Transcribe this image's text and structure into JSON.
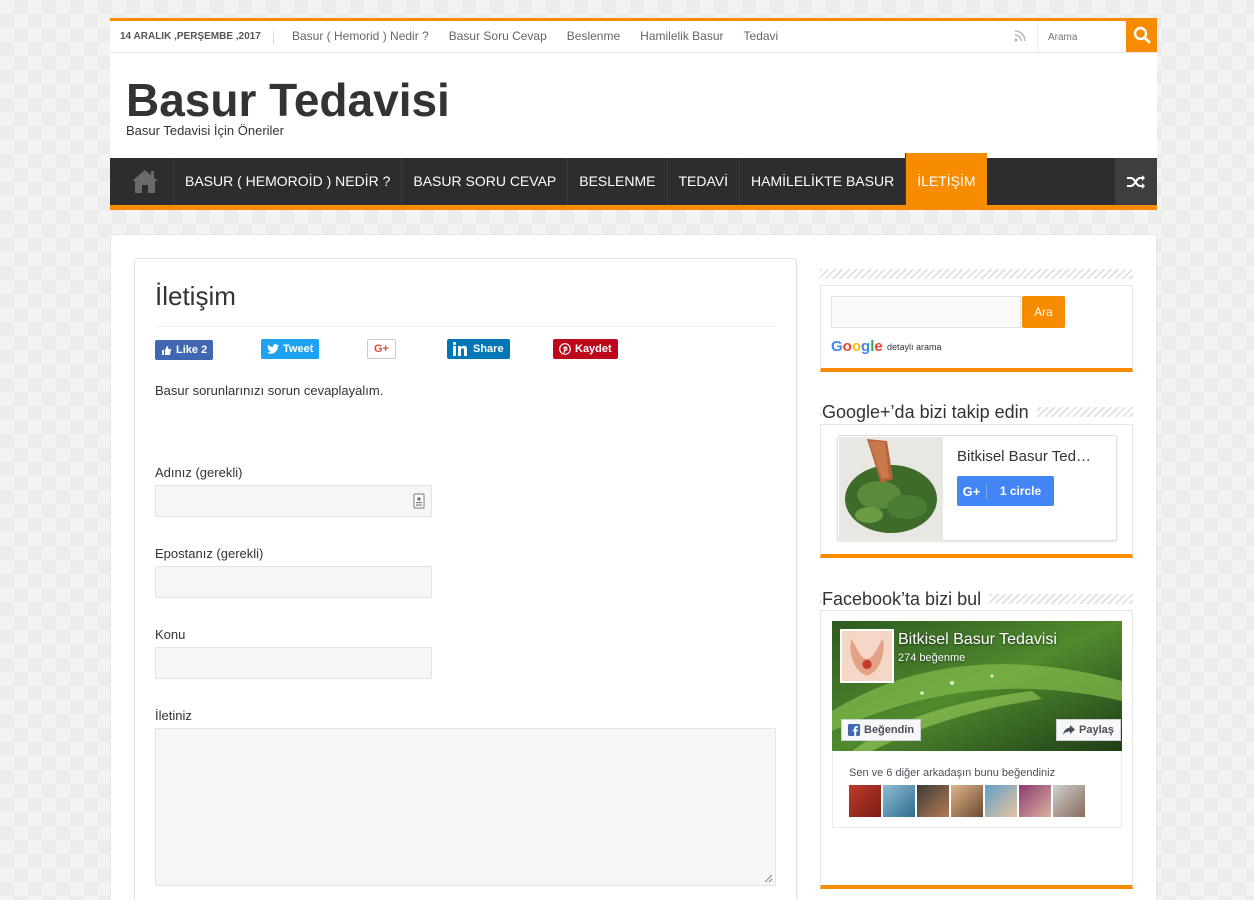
{
  "topbar": {
    "date": "14 ARALIK ,PERŞEMBE ,2017",
    "links": [
      "Basur ( Hemorid ) Nedir ?",
      "Basur Soru Cevap",
      "Beslenme",
      "Hamilelik Basur",
      "Tedavi"
    ],
    "search_placeholder": "Arama"
  },
  "header": {
    "logo": "Basur Tedavisi",
    "tagline": "Basur Tedavisi İçin Öneriler"
  },
  "nav": {
    "items": [
      "BASUR ( HEMOROİD ) NEDİR ?",
      "BASUR SORU CEVAP",
      "BESLENME",
      "TEDAVİ",
      "HAMİLELİKTE BASUR",
      "İLETİŞİM"
    ],
    "active_index": 5
  },
  "post": {
    "title": "İletişim",
    "share": {
      "fb": "Like 2",
      "tw": "Tweet",
      "gp": "G+",
      "li": "Share",
      "pi": "Kaydet"
    },
    "intro": "Basur sorunlarınızı sorun cevaplayalım.",
    "form": {
      "name_label": "Adınız (gerekli)",
      "email_label": "Epostanız (gerekli)",
      "subject_label": "Konu",
      "message_label": "İletiniz"
    }
  },
  "sidebar": {
    "search": {
      "button": "Ara",
      "google": "Google",
      "google_sub": "detaylı arama"
    },
    "gplus": {
      "title": "Google+’da bizi takip edin",
      "page_name": "Bitkisel Basur Ted…",
      "circle_icon": "G+",
      "circle_text": "1 circle"
    },
    "facebook": {
      "title": "Facebook’ta bizi bul",
      "page_name": "Bitkisel Basur Tedavisi",
      "likes": "274 beğenme",
      "like_btn": "Beğendin",
      "share_btn": "Paylaş",
      "friends_text": "Sen ve 6 diğer arkadaşın bunu beğendiniz"
    }
  },
  "colors": {
    "accent": "#f88c00",
    "nav_bg": "#2d2d2d"
  }
}
